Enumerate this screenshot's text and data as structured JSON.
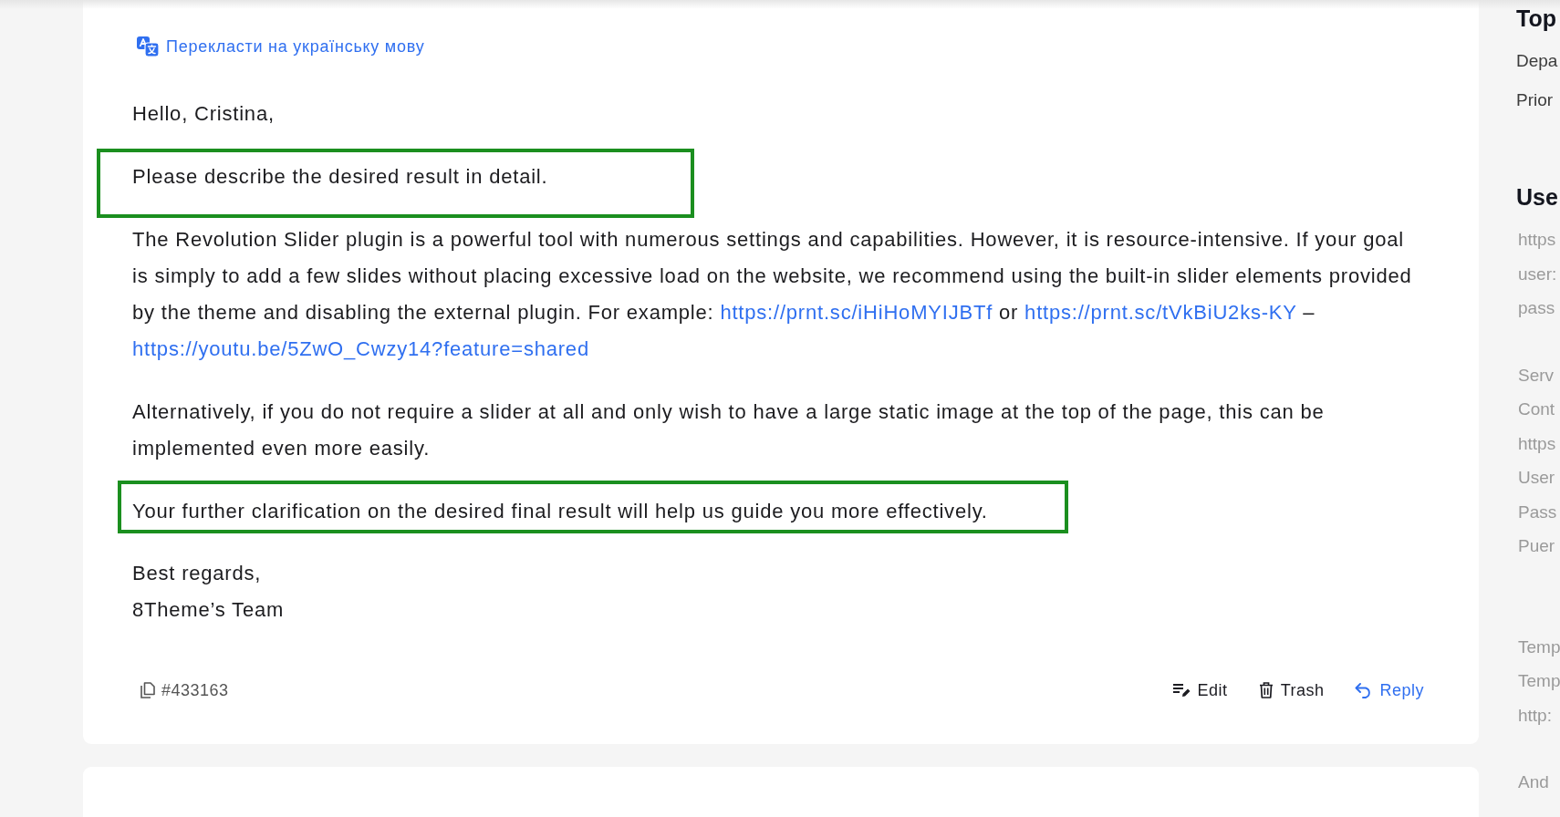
{
  "translate_link": {
    "label": "Перекласти на українську мову"
  },
  "message": {
    "paragraphs": [
      {
        "highlighted": false,
        "parts": [
          {
            "kind": "text",
            "text": "Hello, Cristina,"
          }
        ]
      },
      {
        "highlighted": true,
        "parts": [
          {
            "kind": "text",
            "text": "Please describe the desired result in detail."
          }
        ]
      },
      {
        "highlighted": false,
        "parts": [
          {
            "kind": "text",
            "text": "The Revolution Slider plugin is a powerful tool with numerous settings and capabilities. However, it is resource-intensive. If your goal is simply to add a few slides without placing excessive load on the website, we recommend using the built-in slider elements provided by the theme and disabling the external plugin. For example: "
          },
          {
            "kind": "link",
            "text": "https://prnt.sc/iHiHoMYIJBTf"
          },
          {
            "kind": "text",
            "text": " or "
          },
          {
            "kind": "link",
            "text": "https://prnt.sc/tVkBiU2ks-KY"
          },
          {
            "kind": "text",
            "text": " – "
          },
          {
            "kind": "link",
            "text": "https://youtu.be/5ZwO_Cwzy14?feature=shared"
          }
        ]
      },
      {
        "highlighted": false,
        "parts": [
          {
            "kind": "text",
            "text": "Alternatively, if you do not require a slider at all and only wish to have a large static image at the top of the page, this can be implemented even more easily."
          }
        ]
      },
      {
        "highlighted": true,
        "parts": [
          {
            "kind": "text",
            "text": "Your further clarification on the desired final result will help us guide you more effectively."
          }
        ]
      }
    ],
    "signature": [
      "Best regards,",
      "8Theme’s Team"
    ]
  },
  "footer": {
    "ticket_number": "#433163",
    "actions": [
      {
        "kind": "edit",
        "label": "Edit"
      },
      {
        "kind": "trash",
        "label": "Trash"
      },
      {
        "kind": "reply",
        "label": "Reply"
      }
    ]
  },
  "sidebar": {
    "sections": [
      {
        "heading": "Top",
        "groups": [
          [
            "Depa",
            "Prior"
          ]
        ]
      },
      {
        "heading": "Use",
        "groups": [
          [
            "https",
            "user:",
            "pass"
          ],
          [
            "Serv",
            "Cont",
            "https",
            "User",
            "Pass",
            "Puer"
          ],
          [
            "Temp",
            "Temp",
            "http:"
          ],
          [
            "And"
          ]
        ]
      }
    ]
  }
}
